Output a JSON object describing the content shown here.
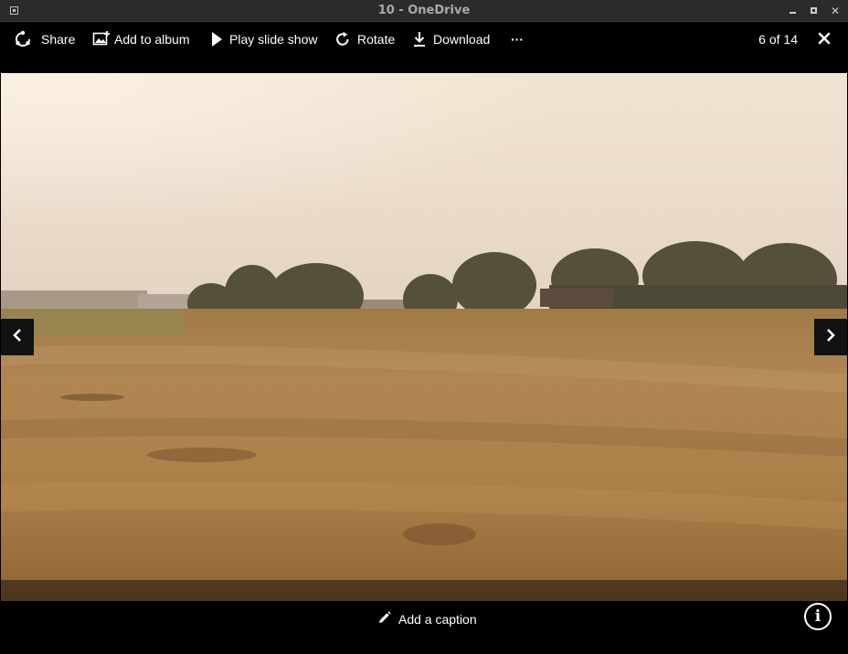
{
  "window": {
    "title": "10 - OneDrive"
  },
  "toolbar": {
    "share_label": "Share",
    "add_album_label": "Add to album",
    "slideshow_label": "Play slide show",
    "rotate_label": "Rotate",
    "download_label": "Download",
    "more_label": "···",
    "counter": "6 of 14"
  },
  "footer": {
    "caption_label": "Add a caption",
    "info_label": "i"
  },
  "icons": [
    "share-icon",
    "add-to-album-icon",
    "play-icon",
    "rotate-icon",
    "download-icon",
    "more-icon",
    "close-icon",
    "chevron-left-icon",
    "chevron-right-icon",
    "pencil-icon",
    "info-icon"
  ]
}
